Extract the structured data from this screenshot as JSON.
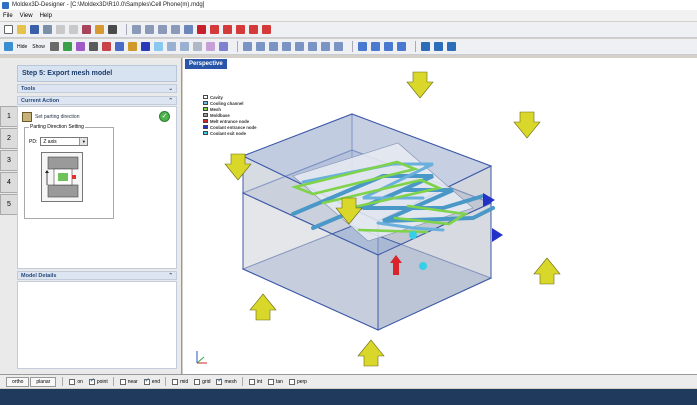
{
  "window": {
    "title": "Moldex3D-Designer - [C:\\Moldex3D\\R10.0\\Samples\\Cell Phone(m).mdg]"
  },
  "menu": [
    "File",
    "View",
    "Help"
  ],
  "toolbar2": {
    "hide_label": "Hide",
    "show_label": "Show"
  },
  "left_panel": {
    "step_title": "Step 5: Export mesh model",
    "tools_label": "Tools",
    "current_action_label": "Current Action",
    "action_item": "Set parting direction",
    "group_title": "Parting Direction Setting",
    "pd_label": "PD:",
    "pd_value": "Z axis",
    "model_details_label": "Model Details",
    "step_tabs": [
      "1",
      "2",
      "3",
      "4",
      "5"
    ]
  },
  "viewport": {
    "tab": "Perspective",
    "legend": [
      {
        "label": "Cavity",
        "color": "#ffffff"
      },
      {
        "label": "Cooling channel",
        "color": "#6fbfe6"
      },
      {
        "label": "Mesh",
        "color": "#7fd34a"
      },
      {
        "label": "Moldbase",
        "color": "#9aa0a6"
      },
      {
        "label": "Melt entrance node",
        "color": "#d9242b"
      },
      {
        "label": "Coolant entrance node",
        "color": "#2431c9"
      },
      {
        "label": "Coolant exit node",
        "color": "#35d0e8"
      }
    ]
  },
  "statusbar": {
    "tabs": [
      "ortho",
      "planar"
    ],
    "snaps": [
      {
        "label": "on",
        "checked": false
      },
      {
        "label": "point",
        "checked": true
      },
      {
        "label": "near",
        "checked": false
      },
      {
        "label": "end",
        "checked": true
      },
      {
        "label": "mid",
        "checked": false
      },
      {
        "label": "grid",
        "checked": false
      },
      {
        "label": "mesh",
        "checked": true
      },
      {
        "label": "int",
        "checked": false
      },
      {
        "label": "tan",
        "checked": false
      },
      {
        "label": "perp",
        "checked": false
      }
    ]
  },
  "colors": {
    "accent": "#2956a8",
    "panel_header": "#d8e3f2"
  }
}
